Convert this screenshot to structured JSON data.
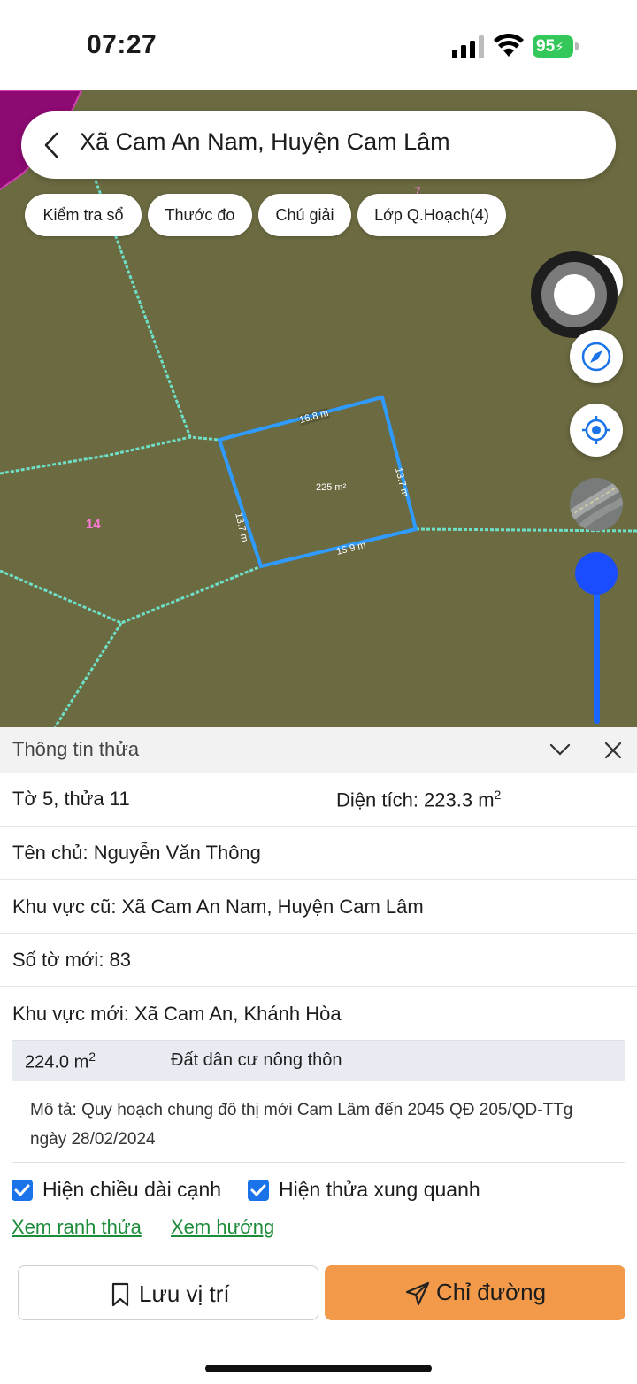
{
  "status_bar": {
    "time": "07:27",
    "battery": "95"
  },
  "search": {
    "title": "Xã Cam An Nam, Huyện Cam Lâm"
  },
  "chips": [
    "Kiểm tra sổ",
    "Thước đo",
    "Chú giải",
    "Lớp Q.Hoạch(4)"
  ],
  "map": {
    "parcel_area": "225 m²",
    "edge_top": "16.8 m",
    "edge_right": "13.7 m",
    "edge_bottom": "15.9 m",
    "edge_left": "13.7 m",
    "neighbor_parcel": "14",
    "top_label": "7",
    "colors": {
      "background": "#6b6a41",
      "boundary": "#6fe0c8",
      "parcel": "#2f9bff",
      "label": "#ff5cc8"
    },
    "icons": [
      "back-icon",
      "record-icon",
      "compass-icon",
      "locate-icon",
      "satellite-layer-icon"
    ]
  },
  "panel": {
    "title": "Thông tin thửa",
    "sheet_parcel": "Tờ 5, thửa 11",
    "area_label": "Diện tích: 223.3 m",
    "area_sup": "2",
    "owner": "Tên chủ: Nguyễn Văn Thông",
    "old_region": "Khu vực cũ: Xã Cam An Nam, Huyện Cam Lâm",
    "new_sheet": "Số tờ mới: 83",
    "new_region": "Khu vực mới: Xã Cam An, Khánh Hòa",
    "plan": {
      "area": "224.0 m",
      "area_sup": "2",
      "land_type": "Đất dân cư nông thôn",
      "description": "Mô tả: Quy hoạch chung đô thị mới Cam Lâm đến 2045 QĐ 205/QD-TTg ngày 28/02/2024"
    },
    "check_edges": "Hiện chiều dài cạnh",
    "check_neighbors": "Hiện thửa xung quanh",
    "link_boundary": "Xem ranh thửa",
    "link_direction": "Xem hướng",
    "save_label": "Lưu vị trí",
    "directions_label": "Chỉ đường"
  }
}
